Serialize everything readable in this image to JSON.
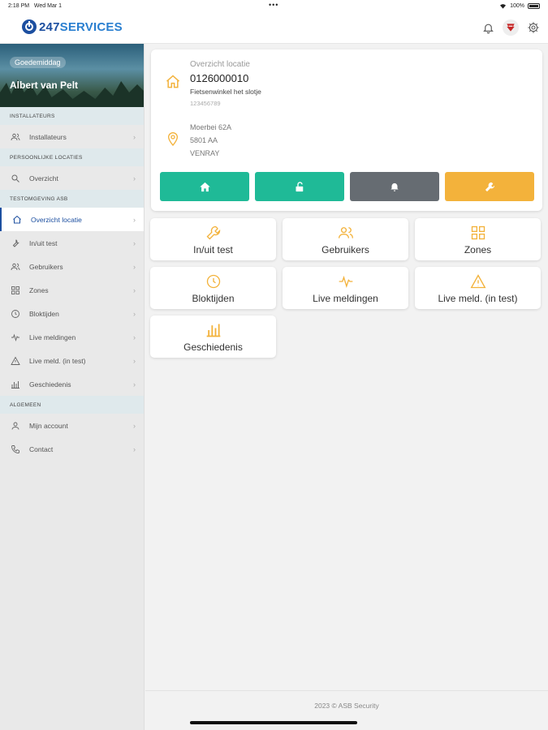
{
  "status": {
    "time": "2:18 PM",
    "date": "Wed Mar 1",
    "dots": "•••",
    "battery": "100%"
  },
  "header": {
    "logo_prefix": "247",
    "logo_suffix": "SERVICES",
    "icons": [
      "bell-icon",
      "user-shield-icon",
      "gear-icon"
    ]
  },
  "profile": {
    "greeting": "Goedemiddag",
    "name": "Albert van Pelt"
  },
  "sidebar": {
    "sections": [
      {
        "title": "INSTALLATEURS",
        "items": [
          {
            "label": "Installateurs",
            "icon": "users-icon"
          }
        ]
      },
      {
        "title": "PERSOONLIJKE LOCATIES",
        "items": [
          {
            "label": "Overzicht",
            "icon": "search-icon"
          }
        ]
      },
      {
        "title": "TESTOMGEVING ASB",
        "items": [
          {
            "label": "Overzicht locatie",
            "icon": "home-icon",
            "active": true
          },
          {
            "label": "In/uit test",
            "icon": "wrench-icon"
          },
          {
            "label": "Gebruikers",
            "icon": "users-icon"
          },
          {
            "label": "Zones",
            "icon": "grid-icon"
          },
          {
            "label": "Bloktijden",
            "icon": "clock-icon"
          },
          {
            "label": "Live meldingen",
            "icon": "pulse-icon"
          },
          {
            "label": "Live meld. (in test)",
            "icon": "warning-icon"
          },
          {
            "label": "Geschiedenis",
            "icon": "chart-icon"
          }
        ]
      },
      {
        "title": "ALGEMEEN",
        "items": [
          {
            "label": "Mijn account",
            "icon": "user-icon"
          },
          {
            "label": "Contact",
            "icon": "phone-icon"
          }
        ]
      }
    ]
  },
  "location": {
    "title": "Overzicht locatie",
    "number": "0126000010",
    "name": "Fietsenwinkel het slotje",
    "code": "123456789",
    "address": [
      "Moerbei 62A",
      "5801 AA",
      "VENRAY"
    ],
    "buttons": [
      {
        "icon": "home-icon",
        "color": "#1fba97"
      },
      {
        "icon": "unlock-icon",
        "color": "#1fba97"
      },
      {
        "icon": "bell-icon",
        "color": "#666c72"
      },
      {
        "icon": "wrench-icon",
        "color": "#f3b23b"
      }
    ]
  },
  "tiles": [
    {
      "label": "In/uit test",
      "icon": "wrench-icon"
    },
    {
      "label": "Gebruikers",
      "icon": "users-icon"
    },
    {
      "label": "Zones",
      "icon": "grid-icon"
    },
    {
      "label": "Bloktijden",
      "icon": "clock-icon"
    },
    {
      "label": "Live meldingen",
      "icon": "pulse-icon"
    },
    {
      "label": "Live meld. (in test)",
      "icon": "warning-icon"
    },
    {
      "label": "Geschiedenis",
      "icon": "chart-icon"
    }
  ],
  "accent_color": "#f3b23b",
  "brand_color": "#1c4fa0",
  "footer": {
    "text": "2023 © ASB Security"
  }
}
